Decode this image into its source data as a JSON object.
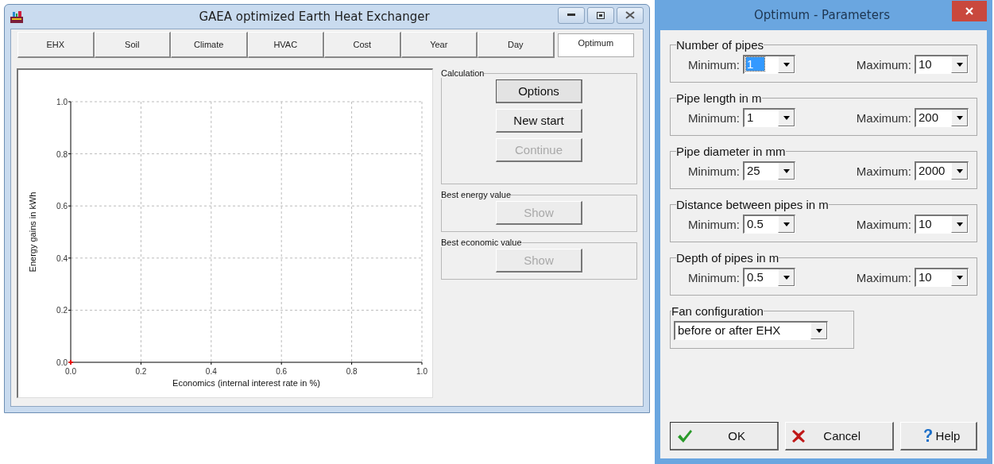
{
  "main_window": {
    "title": "GAEA optimized Earth Heat Exchanger",
    "tabs": [
      {
        "label": "EHX",
        "selected": false
      },
      {
        "label": "Soil",
        "selected": false
      },
      {
        "label": "Climate",
        "selected": false
      },
      {
        "label": "HVAC",
        "selected": false
      },
      {
        "label": "Cost",
        "selected": false
      },
      {
        "label": "Year",
        "selected": false
      },
      {
        "label": "Day",
        "selected": false
      },
      {
        "label": "Optimum",
        "selected": true
      }
    ],
    "chart_data": {
      "type": "scatter",
      "grid": true,
      "x": [
        0
      ],
      "series": [
        {
          "color": "#ff0000",
          "values": [
            0
          ]
        }
      ],
      "xlabel": "Economics (internal interest rate in %)",
      "ylabel": "Energy gains in kWh",
      "xlim": [
        0,
        1
      ],
      "ylim": [
        0,
        1
      ],
      "xticks": [
        {
          "value": 0,
          "label": "0.0"
        },
        {
          "value": 0.2,
          "label": "0.2"
        },
        {
          "value": 0.4,
          "label": "0.4"
        },
        {
          "value": 0.6,
          "label": "0.6"
        },
        {
          "value": 0.8,
          "label": "0.8"
        },
        {
          "value": 1,
          "label": "1.0"
        }
      ],
      "yticks": [
        {
          "value": 0,
          "label": "0.0"
        },
        {
          "value": 0.2,
          "label": "0.2"
        },
        {
          "value": 0.4,
          "label": "0.4"
        },
        {
          "value": 0.6,
          "label": "0.6"
        },
        {
          "value": 0.8,
          "label": "0.8"
        },
        {
          "value": 1,
          "label": "1.0"
        }
      ]
    },
    "panels": [
      {
        "title": "Calculation",
        "buttons": [
          {
            "label": "Options",
            "disabled": false,
            "focused": true
          },
          {
            "label": "New start",
            "disabled": false,
            "focused": false
          },
          {
            "label": "Continue",
            "disabled": true,
            "focused": false
          }
        ]
      },
      {
        "title": "Best energy value",
        "buttons": [
          {
            "label": "Show",
            "disabled": true,
            "focused": false
          }
        ]
      },
      {
        "title": "Best economic value",
        "buttons": [
          {
            "label": "Show",
            "disabled": true,
            "focused": false
          }
        ]
      }
    ]
  },
  "dialog": {
    "title": "Optimum - Parameters",
    "groups": [
      {
        "title": "Number of pipes",
        "minimum": {
          "label": "Minimum:",
          "value": "1",
          "focused": true
        },
        "maximum": {
          "label": "Maximum:",
          "value": "10",
          "focused": false
        }
      },
      {
        "title": "Pipe length in m",
        "minimum": {
          "label": "Minimum:",
          "value": "1",
          "focused": false
        },
        "maximum": {
          "label": "Maximum:",
          "value": "200",
          "focused": false
        }
      },
      {
        "title": "Pipe diameter in mm",
        "minimum": {
          "label": "Minimum:",
          "value": "25",
          "focused": false
        },
        "maximum": {
          "label": "Maximum:",
          "value": "2000",
          "focused": false
        }
      },
      {
        "title": "Distance between pipes in m",
        "minimum": {
          "label": "Minimum:",
          "value": "0.5",
          "focused": false
        },
        "maximum": {
          "label": "Maximum:",
          "value": "10",
          "focused": false
        }
      },
      {
        "title": "Depth of pipes in m",
        "minimum": {
          "label": "Minimum:",
          "value": "0.5",
          "focused": false
        },
        "maximum": {
          "label": "Maximum:",
          "value": "10",
          "focused": false
        }
      }
    ],
    "fan": {
      "title": "Fan configuration",
      "value": "before or after EHX"
    },
    "buttons": [
      {
        "label": "OK",
        "kind": "ok"
      },
      {
        "label": "Cancel",
        "kind": "cancel"
      },
      {
        "label": "Help",
        "kind": "help"
      }
    ]
  }
}
